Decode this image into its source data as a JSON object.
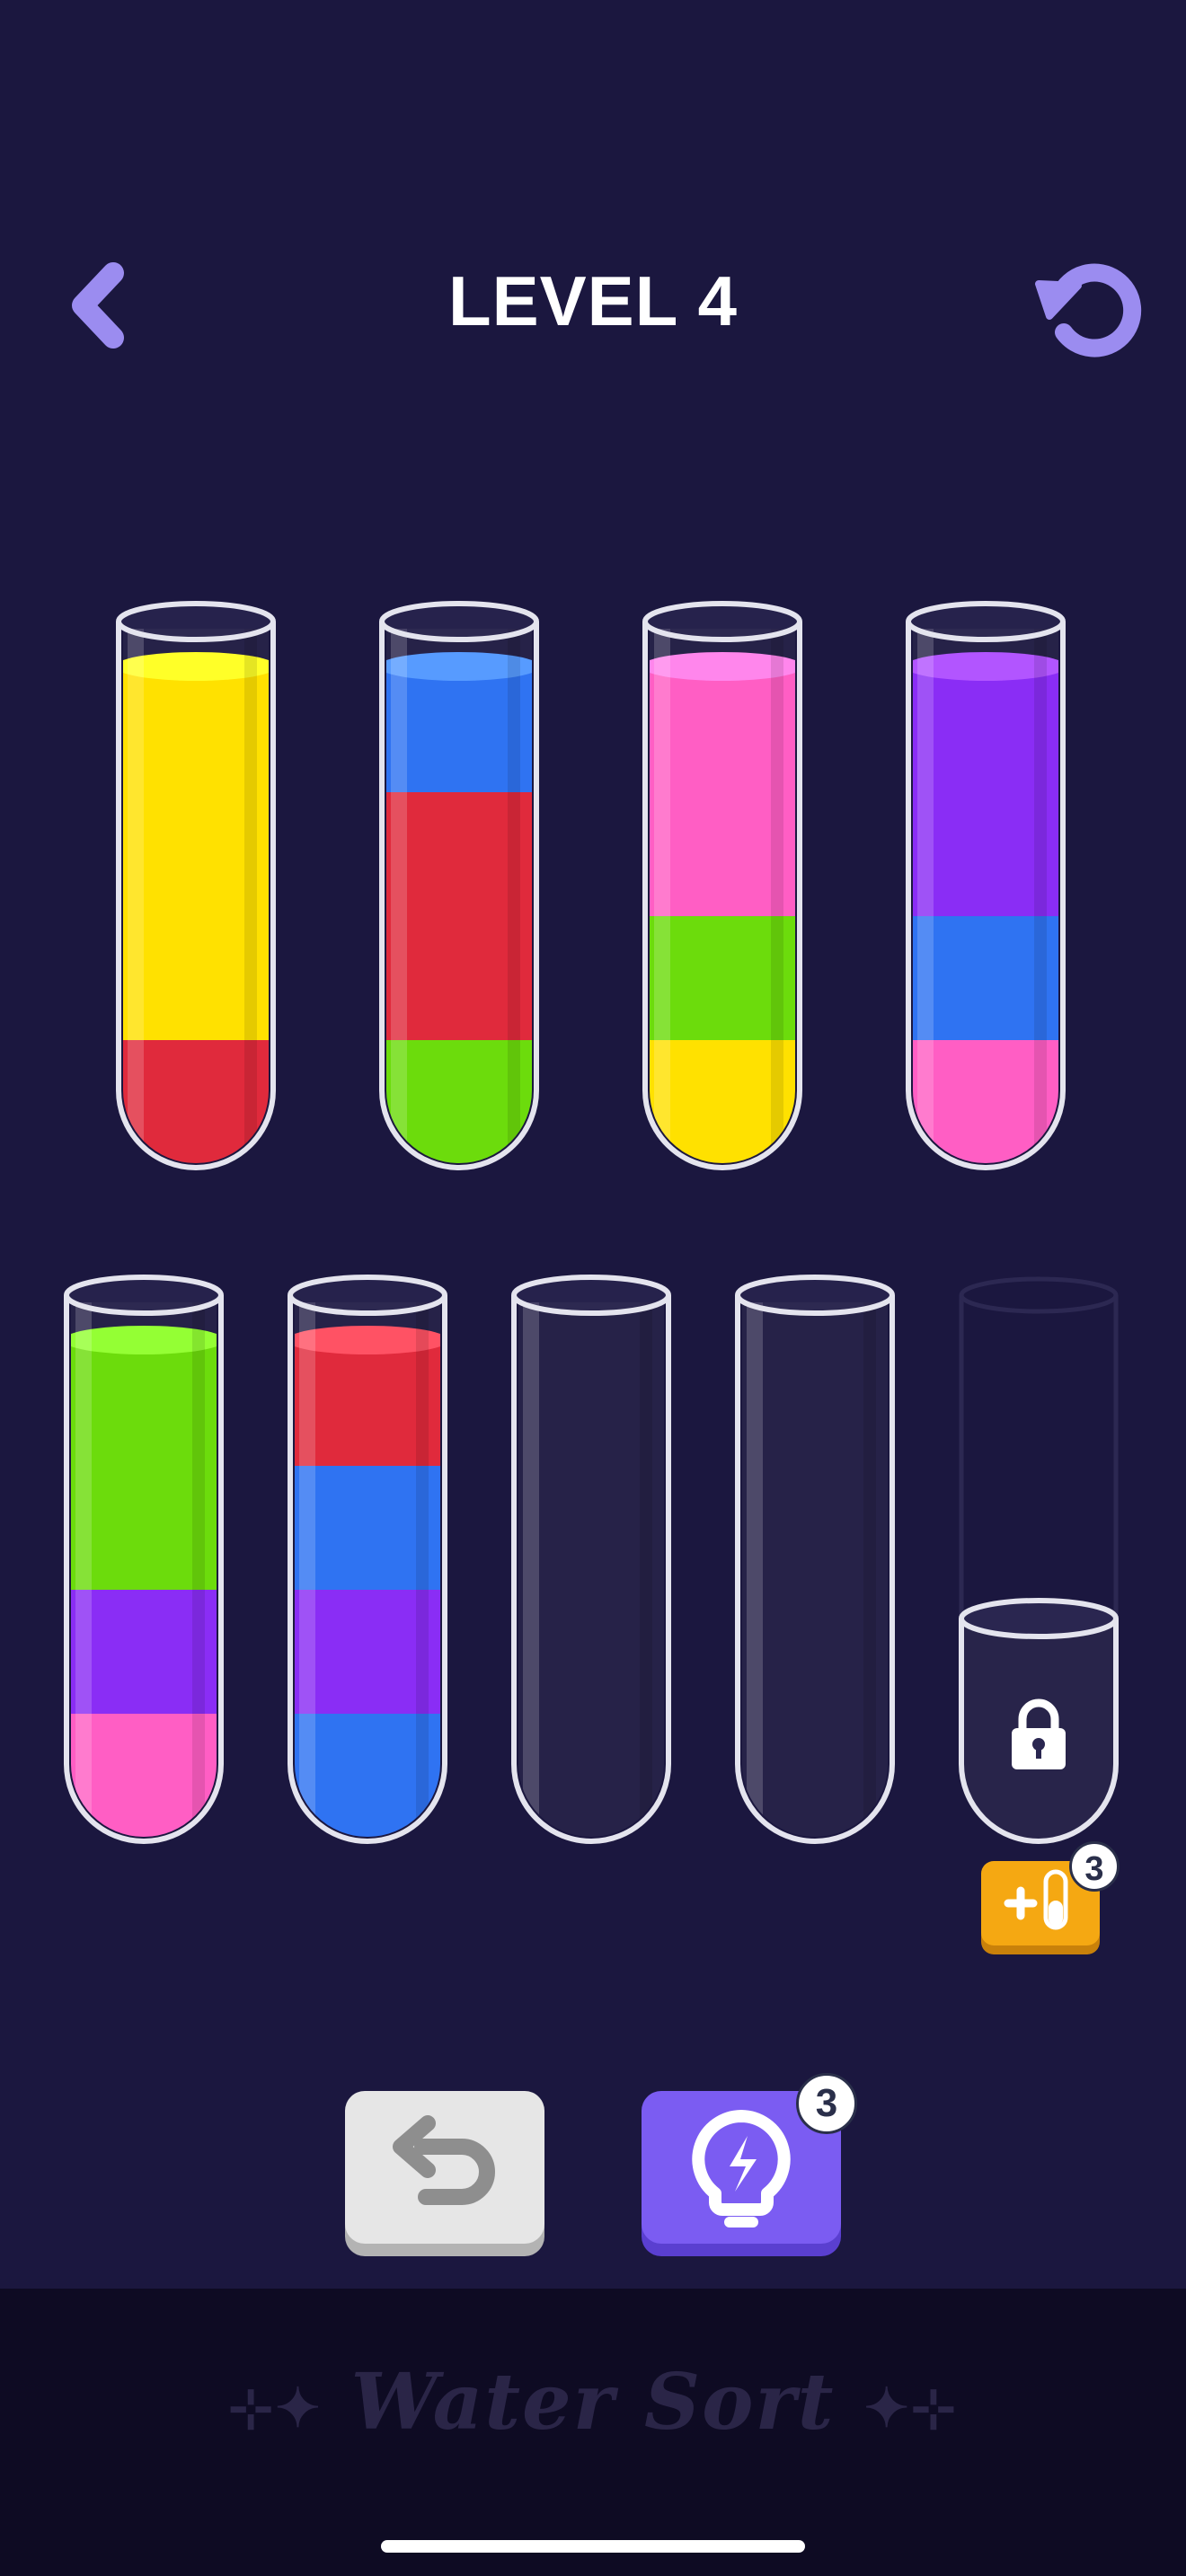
{
  "header": {
    "title": "LEVEL 4",
    "back_icon": "chevron-left-icon",
    "restart_icon": "restart-icon"
  },
  "colors": {
    "background": "#1b173f",
    "accent": "#9b8cf0",
    "yellow": "#ffe100",
    "red": "#e02a3c",
    "green": "#6cdc0c",
    "blue": "#2f73f2",
    "pink": "#ff5ec4",
    "purple": "#8a2df5",
    "hint_button": "#7b5cf2",
    "add_tube_button": "#f5a812"
  },
  "tubes": [
    {
      "layers_bottom_to_top": [
        "red",
        "yellow",
        "yellow",
        "yellow"
      ]
    },
    {
      "layers_bottom_to_top": [
        "green",
        "red",
        "red",
        "blue"
      ]
    },
    {
      "layers_bottom_to_top": [
        "yellow",
        "green",
        "pink",
        "pink"
      ]
    },
    {
      "layers_bottom_to_top": [
        "pink",
        "blue",
        "purple",
        "purple"
      ]
    },
    {
      "layers_bottom_to_top": [
        "pink",
        "purple",
        "green",
        "green"
      ]
    },
    {
      "layers_bottom_to_top": [
        "blue",
        "purple",
        "blue",
        "red"
      ]
    },
    {
      "layers_bottom_to_top": []
    },
    {
      "layers_bottom_to_top": []
    },
    {
      "layers_bottom_to_top": [],
      "locked": true,
      "lock_icon": "lock-icon"
    }
  ],
  "add_tube": {
    "icon": "add-tube-icon",
    "count": "3"
  },
  "buttons": {
    "undo_icon": "undo-icon",
    "hint_icon": "lightbulb-icon",
    "hint_count": "3"
  },
  "footer": {
    "brand": "Water Sort"
  }
}
